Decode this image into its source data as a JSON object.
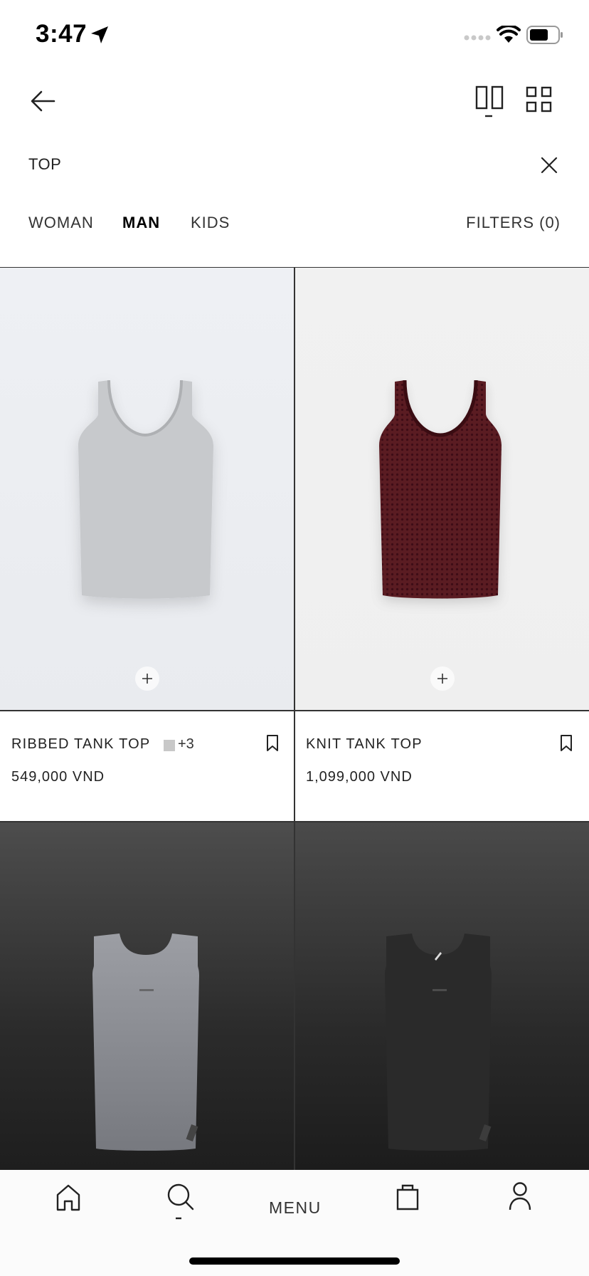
{
  "status_bar": {
    "time": "3:47"
  },
  "search": {
    "query": "TOP"
  },
  "tabs": [
    {
      "label": "WOMAN",
      "active": false
    },
    {
      "label": "MAN",
      "active": true
    },
    {
      "label": "KIDS",
      "active": false
    }
  ],
  "filters_label": "FILTERS (0)",
  "products": [
    {
      "name": "RIBBED TANK TOP",
      "price": "549,000 VND",
      "more_colors": "+3",
      "image": "grey-ribbed-tank-top"
    },
    {
      "name": "KNIT TANK TOP",
      "price": "1,099,000 VND",
      "image": "burgundy-knit-tank-top"
    },
    {
      "image": "grey-athletic-tank-top"
    },
    {
      "image": "black-athletic-tank-top"
    }
  ],
  "bottom_nav": {
    "menu_label": "MENU"
  },
  "icons": [
    "location-arrow-icon",
    "wifi-icon",
    "battery-icon",
    "back-arrow-icon",
    "two-column-view-icon",
    "four-column-view-icon",
    "close-icon",
    "plus-icon",
    "bookmark-icon",
    "home-icon",
    "search-icon",
    "shopping-bag-icon",
    "user-icon"
  ]
}
